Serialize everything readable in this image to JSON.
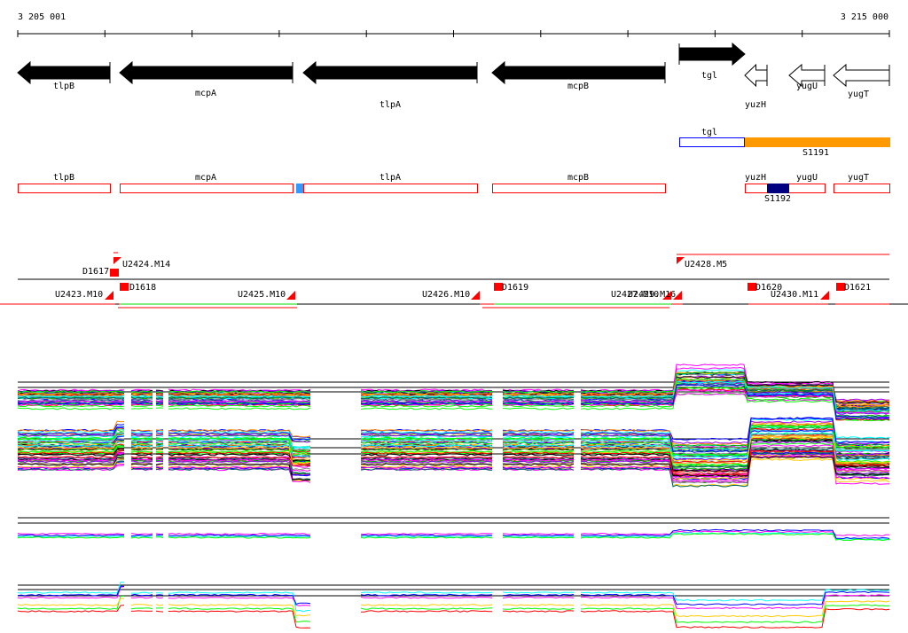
{
  "axis": {
    "start": "3 205 001",
    "end": "3 215 000"
  },
  "genes": [
    {
      "name": "tlpB",
      "strand": "-",
      "fill": "#000000"
    },
    {
      "name": "mcpA",
      "strand": "-",
      "fill": "#000000"
    },
    {
      "name": "tlpA",
      "strand": "-",
      "fill": "#000000"
    },
    {
      "name": "mcpB",
      "strand": "-",
      "fill": "#000000"
    },
    {
      "name": "tgl",
      "strand": "+",
      "fill": "#000000"
    },
    {
      "name": "yuzH",
      "strand": "-",
      "fill": "#ffffff"
    },
    {
      "name": "yugU",
      "strand": "-",
      "fill": "#ffffff"
    },
    {
      "name": "yugT",
      "strand": "-",
      "fill": "#ffffff"
    }
  ],
  "track2": {
    "tgl": "tgl",
    "segment": "S1191",
    "segment_color": "#ff9900",
    "tgl_color": "#0000ff"
  },
  "track3": {
    "labels": [
      "tlpB",
      "mcpA",
      "tlpA",
      "mcpB",
      "yuzH",
      "yugU",
      "yugT"
    ],
    "segment": "S1192",
    "segment_color": "#000080",
    "small_color": "#3399ff",
    "box_color": "#ff0000"
  },
  "features": {
    "upper": [
      "U2424.M14",
      "U2428.M5"
    ],
    "D": [
      "D1617",
      "D1618",
      "D1619",
      "D1620",
      "D1621"
    ],
    "lower": [
      "U2423.M10",
      "U2425.M10",
      "U2426.M10",
      "U2427.M10",
      "U2429.M16",
      "U2430.M11"
    ]
  },
  "colors": {
    "feature": "#ff0000",
    "green": "#00dd00"
  }
}
